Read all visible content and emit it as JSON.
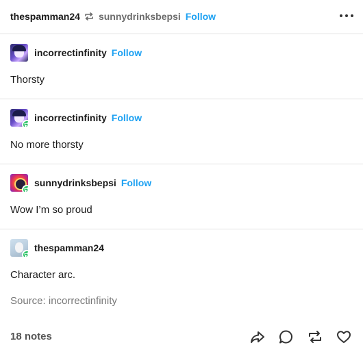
{
  "header": {
    "author": "thespamman24",
    "reblogged_from": "sunnydrinksbepsi",
    "follow_label": "Follow",
    "more_icon": "more-dots-icon"
  },
  "trail": [
    {
      "name": "incorrectinfinity",
      "follow_label": "Follow",
      "body": "Thorsty",
      "avatar": "avatar-incorrectinfinity",
      "reblog_badge": false
    },
    {
      "name": "incorrectinfinity",
      "follow_label": "Follow",
      "body": "No more thorsty",
      "avatar": "avatar-incorrectinfinity",
      "reblog_badge": true
    },
    {
      "name": "sunnydrinksbepsi",
      "follow_label": "Follow",
      "body": "Wow I’m so proud",
      "avatar": "avatar-sunnydrinksbepsi",
      "reblog_badge": true
    },
    {
      "name": "thespamman24",
      "follow_label": "",
      "body": "Character arc.",
      "avatar": "avatar-thespamman24",
      "reblog_badge": true
    }
  ],
  "source": "Source: incorrectinfinity",
  "footer": {
    "notes": "18 notes",
    "actions": [
      "share-icon",
      "comment-icon",
      "reblog-icon",
      "like-icon"
    ]
  },
  "colors": {
    "accent": "#1da1f2",
    "reblog_badge": "#1bbf5a",
    "divider": "#e1e1e1",
    "muted": "#6b6b6b"
  }
}
